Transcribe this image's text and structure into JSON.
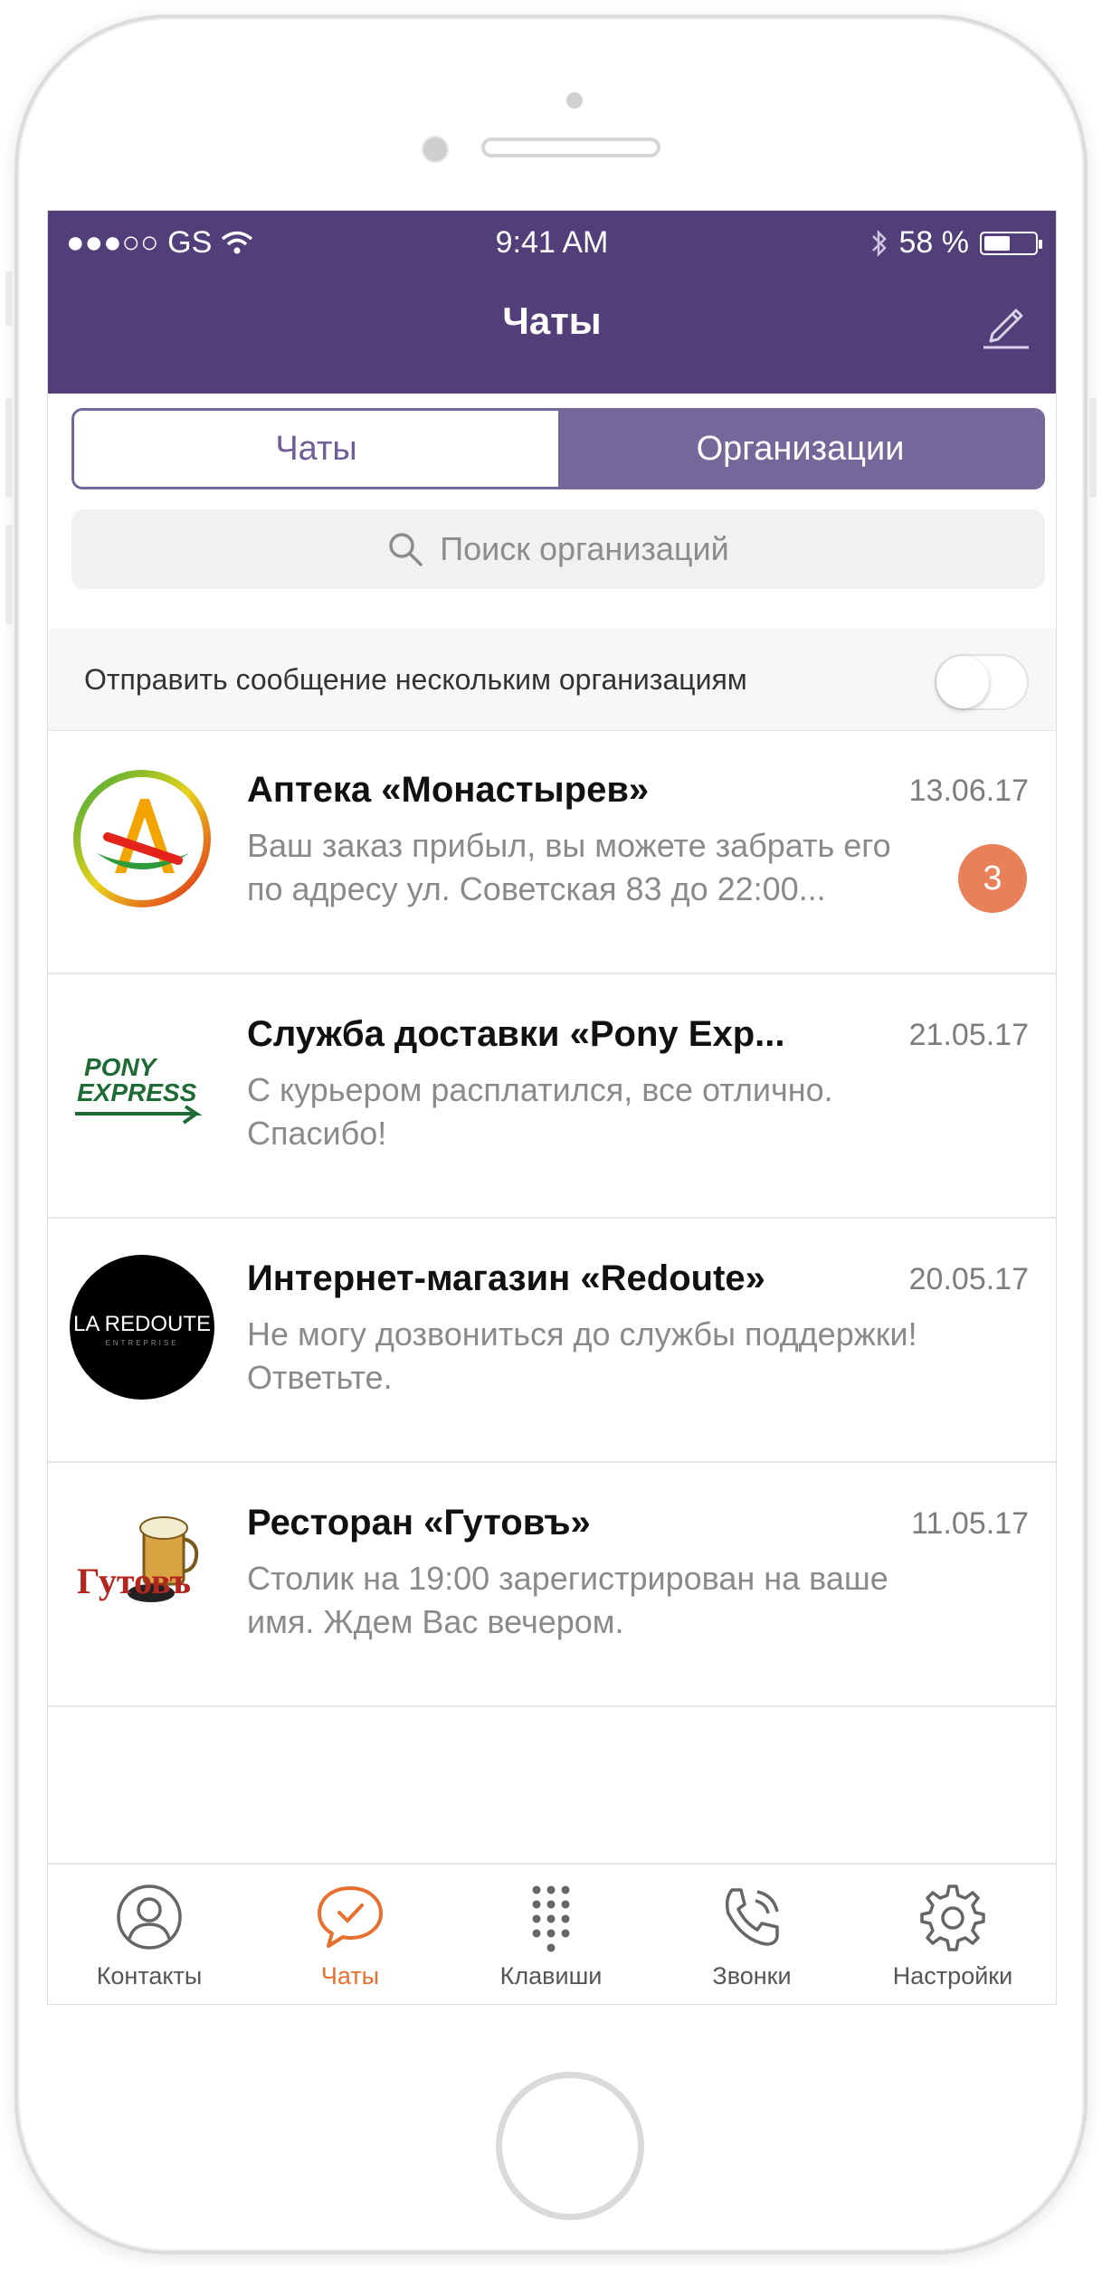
{
  "status_bar": {
    "carrier": "●●●○○ GS",
    "time": "9:41 AM",
    "battery": "58 %"
  },
  "header": {
    "title": "Чаты"
  },
  "segmented": {
    "left": "Чаты",
    "right": "Организации",
    "selected": "right"
  },
  "search": {
    "placeholder": "Поиск организаций"
  },
  "broadcast": {
    "label": "Отправить сообщение нескольким организациям",
    "enabled": false
  },
  "chats": [
    {
      "name": "Аптека «Монастырев»",
      "date": "13.06.17",
      "preview": "Ваш заказ прибыл, вы можете забрать его по адресу ул. Советская 83 до 22:00...",
      "unread": "3"
    },
    {
      "name": "Служба доставки «Pony Exp...",
      "date": "21.05.17",
      "preview": "С курьером расплатился, все отлично. Спасибо!",
      "logo_text_1": "PONY",
      "logo_text_2": "EXPRESS"
    },
    {
      "name": "Интернет-магазин «Redoute»",
      "date": "20.05.17",
      "preview": "Не могу дозвониться до службы поддержки! Ответьте.",
      "logo_text": "LA REDOUTE",
      "logo_subtext": "ENTREPRISE"
    },
    {
      "name": "Ресторан «Гутовъ»",
      "date": "11.05.17",
      "preview": "Столик на 19:00 зарегистрирован на ваше имя. Ждем Вас вечером.",
      "logo_text": "Гутовъ"
    }
  ],
  "tabbar": [
    {
      "label": "Контакты",
      "icon": "contacts-icon"
    },
    {
      "label": "Чаты",
      "icon": "chats-icon",
      "active": true
    },
    {
      "label": "Клавиши",
      "icon": "keypad-icon"
    },
    {
      "label": "Звонки",
      "icon": "calls-icon"
    },
    {
      "label": "Настройки",
      "icon": "settings-icon"
    }
  ],
  "colors": {
    "header": "#523e78",
    "segment_active": "#76679a",
    "accent_orange": "#e8702e",
    "badge": "#e8805a"
  }
}
